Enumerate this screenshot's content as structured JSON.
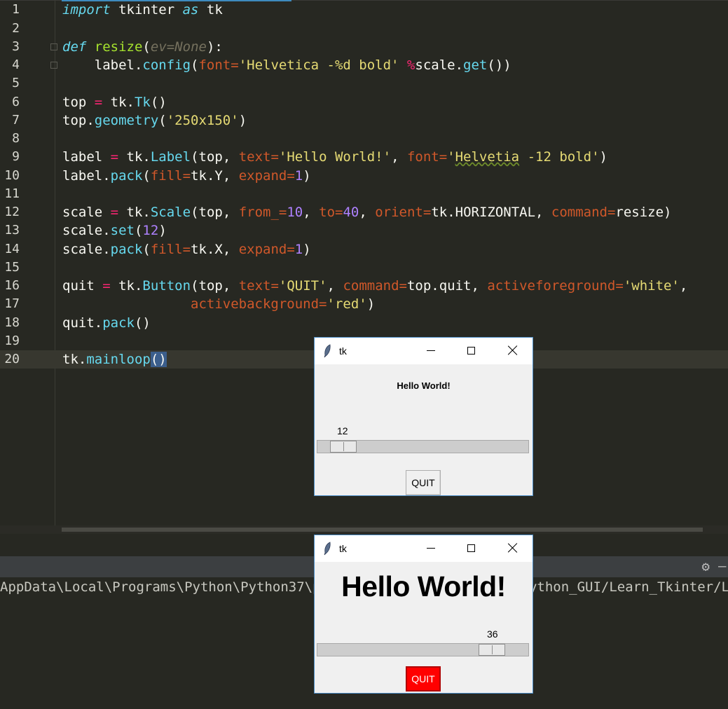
{
  "editor": {
    "line_numbers": [
      "1",
      "2",
      "3",
      "4",
      "5",
      "6",
      "7",
      "8",
      "9",
      "10",
      "11",
      "12",
      "13",
      "14",
      "15",
      "16",
      "17",
      "18",
      "19",
      "20"
    ],
    "lines": {
      "l1": {
        "a": "import",
        "b": " tkinter ",
        "c": "as",
        "d": " tk"
      },
      "l3": {
        "a": "def",
        "b": " ",
        "c": "resize",
        "d": "(",
        "e": "ev=None",
        "f": "):"
      },
      "l4": {
        "a": "    label.",
        "b": "config",
        "c": "(",
        "d": "font=",
        "e": "'Helvetica -%d bold'",
        "f": " ",
        "g": "%",
        "h": "scale.",
        "i": "get",
        "j": "())"
      },
      "l6": {
        "a": "top ",
        "b": "=",
        "c": " tk.",
        "d": "Tk",
        "e": "()"
      },
      "l7": {
        "a": "top.",
        "b": "geometry",
        "c": "(",
        "d": "'250x150'",
        "e": ")"
      },
      "l9": {
        "a": "label ",
        "b": "=",
        "c": " tk.",
        "d": "Label",
        "e": "(top, ",
        "f": "text=",
        "g": "'Hello World!'",
        "h": ", ",
        "i": "font=",
        "j": "'",
        "k": "Helvetia",
        "l": " -12 bold'",
        "m": ")"
      },
      "l10": {
        "a": "label.",
        "b": "pack",
        "c": "(",
        "d": "fill=",
        "e": "tk.Y, ",
        "f": "expand=",
        "g": "1",
        "h": ")"
      },
      "l12": {
        "a": "scale ",
        "b": "=",
        "c": " tk.",
        "d": "Scale",
        "e": "(top, ",
        "f": "from_=",
        "g": "10",
        "h": ", ",
        "i": "to=",
        "j": "40",
        "k": ", ",
        "l": "orient=",
        "m": "tk.HORIZONTAL, ",
        "n": "command=",
        "o": "resize)"
      },
      "l13": {
        "a": "scale.",
        "b": "set",
        "c": "(",
        "d": "12",
        "e": ")"
      },
      "l14": {
        "a": "scale.",
        "b": "pack",
        "c": "(",
        "d": "fill=",
        "e": "tk.X, ",
        "f": "expand=",
        "g": "1",
        "h": ")"
      },
      "l16": {
        "a": "quit ",
        "b": "=",
        "c": " tk.",
        "d": "Button",
        "e": "(top, ",
        "f": "text=",
        "g": "'QUIT'",
        "h": ", ",
        "i": "command=",
        "j": "top.quit, ",
        "k": "activeforeground=",
        "l": "'white'",
        "m": ","
      },
      "l17": {
        "a": "                ",
        "b": "activebackground=",
        "c": "'red'",
        "d": ")"
      },
      "l18": {
        "a": "quit.",
        "b": "pack",
        "c": "()"
      },
      "l20": {
        "a": "tk.",
        "b": "mainloop",
        "c": "()"
      }
    }
  },
  "console": {
    "path_text": "AppData\\Local\\Programs\\Python\\Python37\\python.exe C:/Users/Learn_Python_GUI/Learn_Tkinter/Lab"
  },
  "tk_window_1": {
    "title": "tk",
    "label_text": "Hello World!",
    "scale_value": "12",
    "scale_fraction": 0.067,
    "button_label": "QUIT"
  },
  "tk_window_2": {
    "title": "tk",
    "label_text": "Hello World!",
    "scale_value": "36",
    "scale_fraction": 0.867,
    "button_label": "QUIT"
  },
  "colors": {
    "editor_bg": "#272822",
    "keyword": "#66d9ef",
    "function": "#a6e22e",
    "string": "#e6db74",
    "number": "#ae81ff",
    "argument": "#d0582a",
    "button_active_bg": "#ff0000"
  }
}
